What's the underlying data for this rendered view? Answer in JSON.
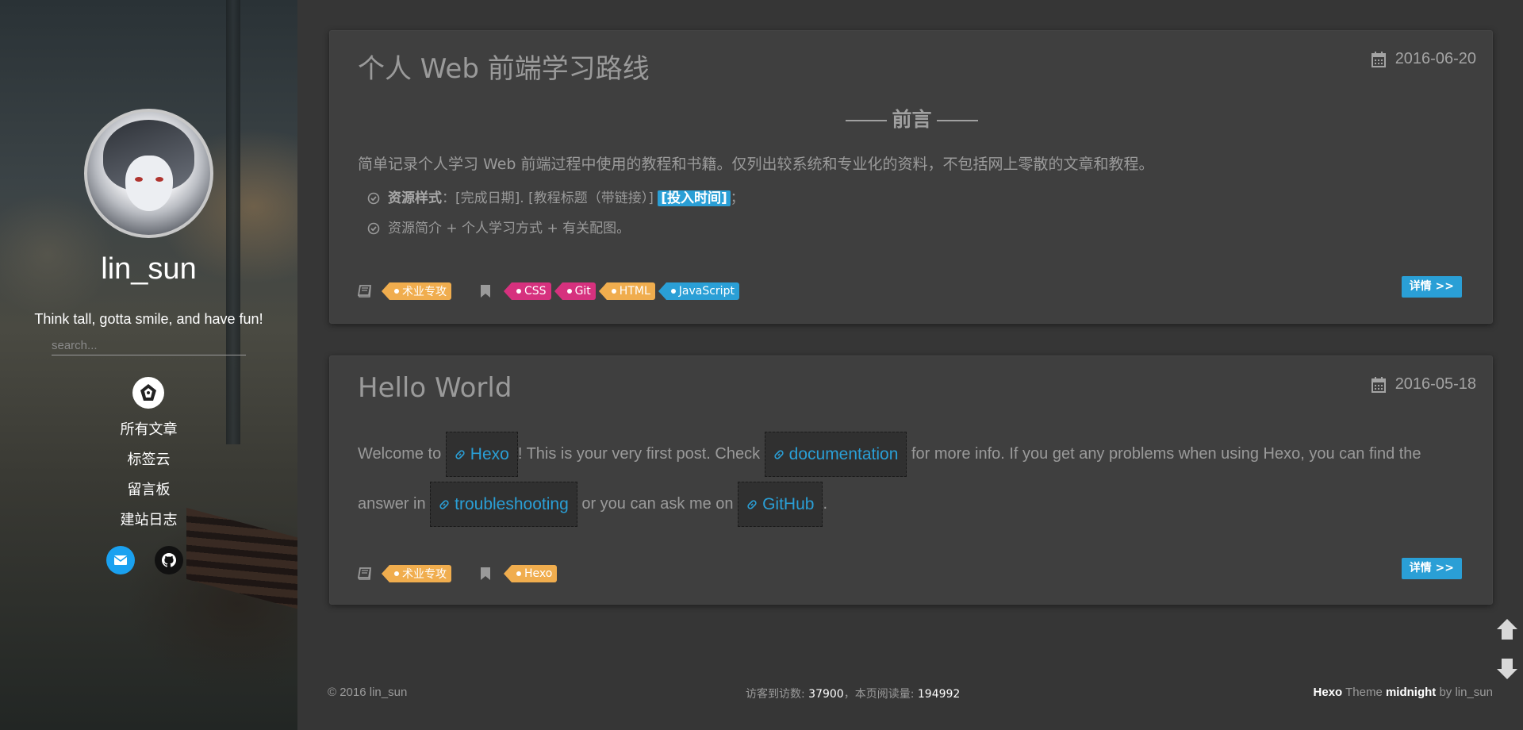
{
  "sidebar": {
    "username": "lin_sun",
    "tagline": "Think tall, gotta smile, and have fun!",
    "search_placeholder": "search...",
    "nav": [
      "所有文章",
      "标签云",
      "留言板",
      "建站日志"
    ]
  },
  "posts": [
    {
      "title": "个人 Web 前端学习路线",
      "date": "2016-06-20",
      "preface": "前言",
      "intro": "简单记录个人学习 Web 前端过程中使用的教程和书籍。仅列出较系统和专业化的资料，不包括网上零散的文章和教程。",
      "bullet1_bold": "资源样式",
      "bullet1_text": "：[完成日期]. [教程标题（带链接）]",
      "bullet1_highlight": "[投入时间]",
      "bullet1_end": "；",
      "bullet2": "资源简介 + 个人学习方式 + 有关配图。",
      "category": "术业专攻",
      "tags": [
        "CSS",
        "Git",
        "HTML",
        "JavaScript"
      ],
      "detail": "详情 >>"
    },
    {
      "title": "Hello World",
      "date": "2016-05-18",
      "text1": "Welcome to ",
      "link1": "Hexo",
      "text2": "! This is your very first post. Check ",
      "link2": "documentation",
      "text3": " for more info. If you get any problems when using Hexo, you can find the answer in ",
      "link3": "troubleshooting",
      "text4": " or you can ask me on ",
      "link4": "GitHub",
      "text5": ".",
      "category": "术业专攻",
      "tags": [
        "Hexo"
      ],
      "detail": "详情 >>"
    }
  ],
  "footer": {
    "copyright": "© 2016 lin_sun",
    "visits_label": "访客到访数: ",
    "visits": "37900",
    "reads_label": "，本页阅读量: ",
    "reads": "194992",
    "theme_hexo": "Hexo",
    "theme_word": " Theme ",
    "theme_name": "midnight",
    "theme_by": " by lin_sun"
  },
  "colors": {
    "accent": "#2a9fd6",
    "tag_orange": "#f0ad4e",
    "tag_pink": "#d6317e",
    "background": "#363636",
    "card": "#3f3f3f"
  }
}
